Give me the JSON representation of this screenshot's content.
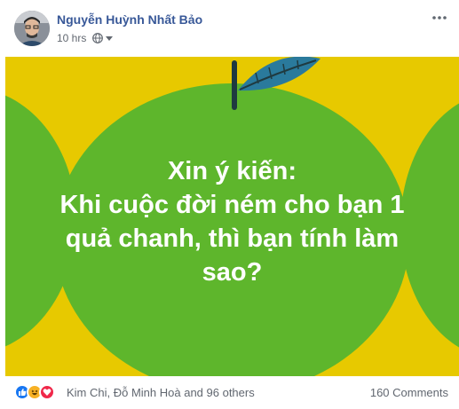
{
  "post": {
    "author": "Nguyễn Huỳnh Nhất Bảo",
    "time": "10 hrs",
    "privacy_icon": "globe-icon",
    "menu_icon": "more-horizontal-icon",
    "image": {
      "caption_lines": [
        "Xin ý kiến:",
        "Khi cuộc đời ném cho bạn 1",
        "quả chanh, thì bạn tính làm",
        "sao?"
      ],
      "colors": {
        "background": "#e7c900",
        "fruit": "#5eb62c",
        "leaf": "#2a7a9c",
        "text": "#ffffff"
      }
    },
    "reactions": {
      "icons": [
        "like-icon",
        "haha-icon",
        "love-icon"
      ],
      "summary": "Kim Chi, Đỗ Minh Hoà and 96 others"
    },
    "comments": "160 Comments"
  }
}
